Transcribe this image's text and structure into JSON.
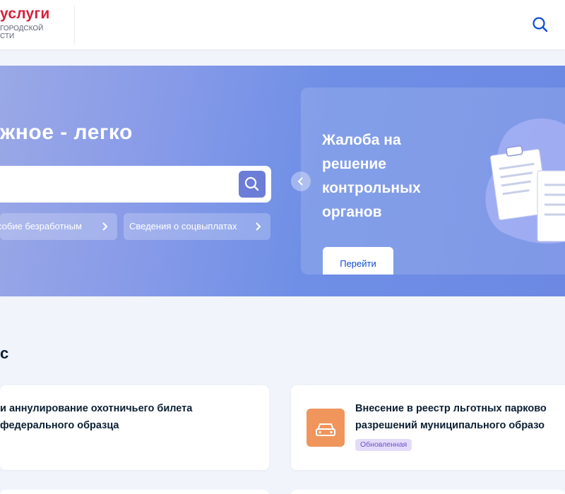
{
  "header": {
    "logo_main": "услуги",
    "logo_sub_line1": "городской",
    "logo_sub_line2": "сти",
    "search_icon": "search-icon"
  },
  "hero": {
    "title": "жное - легко",
    "search_placeholder": "",
    "chips": [
      {
        "label": "собие безработным",
        "icon": "chevron-right-icon"
      },
      {
        "label": "Сведения о соцвыплатах",
        "icon": "chevron-right-icon"
      }
    ],
    "promo": {
      "title": "Жалоба на решение контрольных органов",
      "button_label": "Перейти"
    }
  },
  "services": {
    "section_title": "с",
    "cards": [
      {
        "title_line1": "и аннулирование охотничьего билета",
        "title_line2": "федерального образца"
      },
      {
        "title_line1": "Внесение в реестр льготных парково",
        "title_line2": "разрешений муниципального образо",
        "badge": "Обновленная",
        "icon": "car-icon"
      }
    ]
  },
  "colors": {
    "accent": "#0d4cd3",
    "logo_red": "#d3213b",
    "card_icon_bg": "#f0955c",
    "badge_bg": "#e4dbfb"
  }
}
